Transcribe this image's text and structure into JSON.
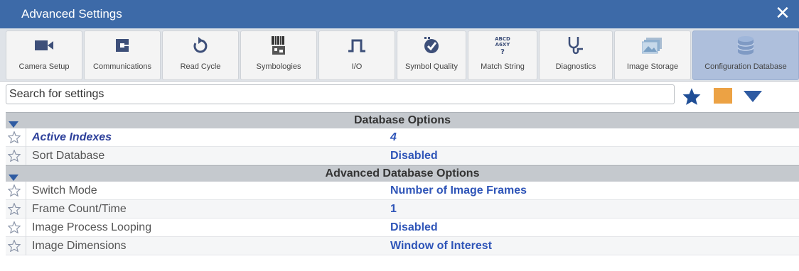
{
  "window": {
    "title": "Advanced Settings",
    "close_icon": "close-icon"
  },
  "toolbar": {
    "items": [
      {
        "label": "Camera Setup",
        "icon": "camera-icon"
      },
      {
        "label": "Communications",
        "icon": "communications-icon"
      },
      {
        "label": "Read Cycle",
        "icon": "refresh-icon"
      },
      {
        "label": "Symbologies",
        "icon": "barcode-icon"
      },
      {
        "label": "I/O",
        "icon": "pulse-icon"
      },
      {
        "label": "Symbol Quality",
        "icon": "symbol-quality-icon"
      },
      {
        "label": "Match String",
        "icon": "match-string-icon"
      },
      {
        "label": "Diagnostics",
        "icon": "stethoscope-icon"
      },
      {
        "label": "Image Storage",
        "icon": "image-storage-icon"
      },
      {
        "label": "Configuration Database",
        "icon": "database-icon",
        "active": true
      }
    ]
  },
  "search": {
    "placeholder": "Search for settings"
  },
  "colors": {
    "accent": "#3d6aa8",
    "active_tab": "#aebfdc",
    "value": "#2f55b8",
    "orange": "#eca244",
    "star_blue": "#1f4e96"
  },
  "sections": [
    {
      "title": "Database Options",
      "rows": [
        {
          "name": "Active Indexes",
          "value": "4",
          "highlight": true
        },
        {
          "name": "Sort Database",
          "value": "Disabled"
        }
      ]
    },
    {
      "title": "Advanced Database Options",
      "rows": [
        {
          "name": "Switch Mode",
          "value": "Number of Image Frames"
        },
        {
          "name": "Frame Count/Time",
          "value": "1"
        },
        {
          "name": "Image Process Looping",
          "value": "Disabled"
        },
        {
          "name": "Image Dimensions",
          "value": "Window of Interest"
        }
      ]
    }
  ]
}
